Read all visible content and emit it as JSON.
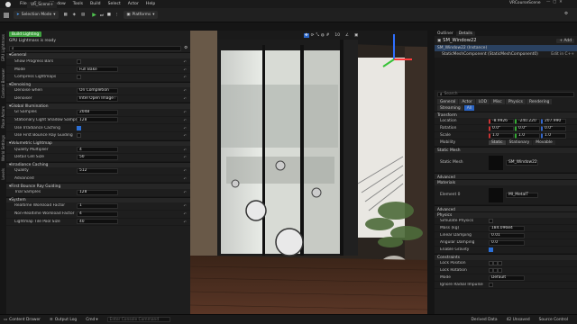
{
  "app": {
    "project": "VRCourseScene",
    "level_tab": "VR_Scene+"
  },
  "menu": [
    "File",
    "Edit",
    "Window",
    "Tools",
    "Build",
    "Select",
    "Actor",
    "Help"
  ],
  "toolbar": {
    "selection_mode": "Selection Mode",
    "platforms": "Platforms"
  },
  "left_tabs": [
    "GPU Lightmass",
    "Content Browser",
    "Place Actors",
    "World Settings",
    "Levels"
  ],
  "light_panel": {
    "build_button": "Build Lighting",
    "status": "GPU Lightmass is ready",
    "viewport_realtime": "Viewport Realtime is OFF",
    "sections": [
      {
        "title": "General",
        "rows": [
          {
            "name": "Show Progress Bars",
            "type": "check",
            "value": false
          },
          {
            "name": "Mode",
            "type": "field",
            "value": "Full Bake"
          },
          {
            "name": "Compress Lightmaps",
            "type": "check",
            "value": false
          }
        ]
      },
      {
        "title": "Denoising",
        "rows": [
          {
            "name": "Denoise when",
            "type": "field",
            "value": "On Completion"
          },
          {
            "name": "Denoiser",
            "type": "field",
            "value": "Intel Open Image Denoise"
          }
        ]
      },
      {
        "title": "Global Illumination",
        "rows": [
          {
            "name": "GI Samples",
            "type": "field",
            "value": "2048"
          },
          {
            "name": "Stationary Light Shadow Samples",
            "type": "field",
            "value": "128"
          },
          {
            "name": "Use Irradiance Caching",
            "type": "check",
            "value": true
          },
          {
            "name": "Use First Bounce Ray Guiding",
            "type": "check",
            "value": false
          }
        ]
      },
      {
        "title": "Volumetric Lightmap",
        "rows": [
          {
            "name": "Quality Multiplier",
            "type": "field",
            "value": "4"
          },
          {
            "name": "Detail Cell Size",
            "type": "field",
            "value": "50"
          }
        ]
      },
      {
        "title": "Irradiance Caching",
        "rows": [
          {
            "name": "Quality",
            "type": "field",
            "value": "512"
          },
          {
            "name": "Advanced",
            "type": "none",
            "value": ""
          }
        ]
      },
      {
        "title": "First Bounce Ray Guiding",
        "rows": [
          {
            "name": "Trial Samples",
            "type": "field",
            "value": "128"
          }
        ]
      },
      {
        "title": "System",
        "rows": [
          {
            "name": "Realtime Workload Factor",
            "type": "field",
            "value": "1"
          },
          {
            "name": "Non-Realtime Workload Factor",
            "type": "field",
            "value": "4"
          },
          {
            "name": "Lightmap Tile Pool Size",
            "type": "field",
            "value": "40"
          }
        ]
      }
    ]
  },
  "outliner": {
    "tab": "Outliner",
    "details_tab": "Details"
  },
  "details": {
    "actor": "SM_Window22",
    "add_label": "+ Add",
    "instance": "SM_Window22 (Instance)",
    "component": "StaticMeshComponent (StaticMeshComponent0)",
    "edit_in_cpp": "Edit in C++",
    "search_placeholder": "Search",
    "filters": [
      "General",
      "Actor",
      "LOD",
      "Misc",
      "Physics",
      "Rendering",
      "Streaming",
      "All"
    ],
    "transform": {
      "title": "Transform",
      "location": [
        "-8.9926",
        "-240.220",
        "207.990"
      ],
      "rotation": [
        "0.0°",
        "0.0°",
        "0.0°"
      ],
      "scale": [
        "1.0",
        "1.0",
        "1.0"
      ],
      "mobility": [
        "Static",
        "Stationary",
        "Movable"
      ]
    },
    "static_mesh": {
      "title": "Static Mesh",
      "label": "Static Mesh",
      "value": "SM_Window22"
    },
    "materials": {
      "title": "Materials",
      "label": "Element 0",
      "value": "MI_MetalT"
    },
    "physics": {
      "title": "Physics",
      "rows": [
        "Simulate Physics",
        "Mass (kg)",
        "Linear Damping",
        "Angular Damping",
        "Enable Gravity"
      ],
      "values": [
        "",
        "184.09684",
        "0.01",
        "0.0",
        ""
      ]
    },
    "constraints": {
      "title": "Constraints",
      "rows": [
        "Lock Position",
        "Lock Rotation",
        "Mode"
      ],
      "mode_value": "Default"
    },
    "extra_rows": [
      "Ignore Radial Impulse"
    ]
  },
  "statusbar": {
    "content_drawer": "Content Drawer",
    "output_log": "Output Log",
    "cmd": "Cmd",
    "cmd_placeholder": "Enter Console Command",
    "derived_data": "Derived Data",
    "unsaved": "42 Unsaved",
    "source_control": "Source Control"
  }
}
